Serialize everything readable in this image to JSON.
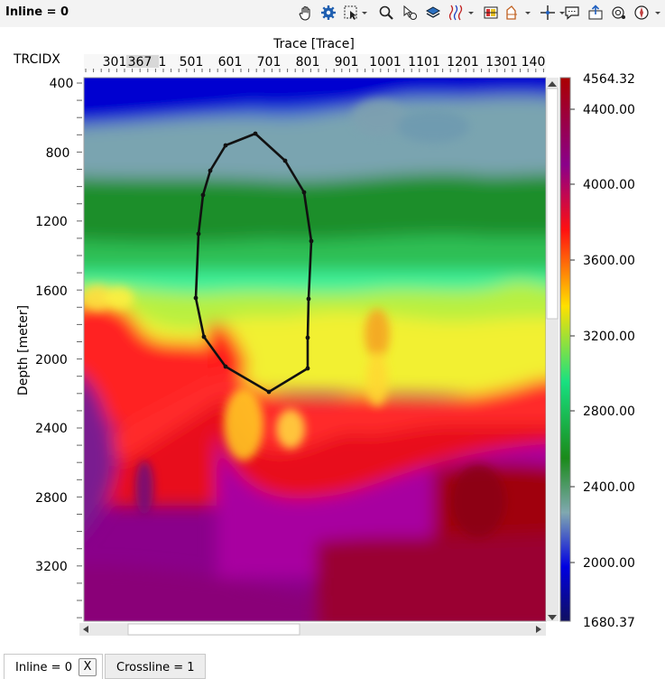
{
  "window": {
    "title": "Inline = 0"
  },
  "toolbar": {
    "tools": [
      {
        "name": "pan-tool-icon"
      },
      {
        "name": "settings-tool-icon"
      },
      {
        "name": "select-area-icon",
        "dropdown": true
      },
      {
        "name": "zoom-icon"
      },
      {
        "name": "pick-icon"
      },
      {
        "name": "layers-icon"
      },
      {
        "name": "wiggle-display-icon",
        "dropdown": true
      },
      {
        "name": "vd-display-icon"
      },
      {
        "name": "horizon-icon",
        "dropdown": true
      },
      {
        "name": "crosshair-icon",
        "dropdown": true
      },
      {
        "name": "annotation-icon"
      },
      {
        "name": "export-icon"
      },
      {
        "name": "snapshot-icon"
      },
      {
        "name": "compass-icon",
        "dropdown": true
      }
    ]
  },
  "plot": {
    "x_axis_title": "Trace [Trace]",
    "x_secondary_axis_label": "TRCIDX",
    "y_axis_title": "Depth [meter]",
    "x_tick_labels": [
      "301",
      "367",
      "1",
      "501",
      "601",
      "701",
      "801",
      "901",
      "1001",
      "1101",
      "1201",
      "1301",
      "140"
    ],
    "y_tick_labels": [
      "400",
      "800",
      "1200",
      "1600",
      "2000",
      "2400",
      "2800",
      "3200"
    ],
    "polygon_color": "#111111"
  },
  "colorbar": {
    "max_label": "4564.32",
    "min_label": "1680.37",
    "tick_labels": [
      "4400.00",
      "4000.00",
      "3600.00",
      "3200.00",
      "2800.00",
      "2400.00",
      "2000.00"
    ],
    "palette": [
      "#aa0000",
      "#8a008a",
      "#ff1010",
      "#ffe000",
      "#18e080",
      "#1a8a1a",
      "#80a8b0",
      "#0000e0",
      "#101060"
    ]
  },
  "tabs": [
    {
      "label": "Inline = 0",
      "active": true,
      "close_label": "X"
    },
    {
      "label": "Crossline = 1",
      "active": false
    }
  ]
}
